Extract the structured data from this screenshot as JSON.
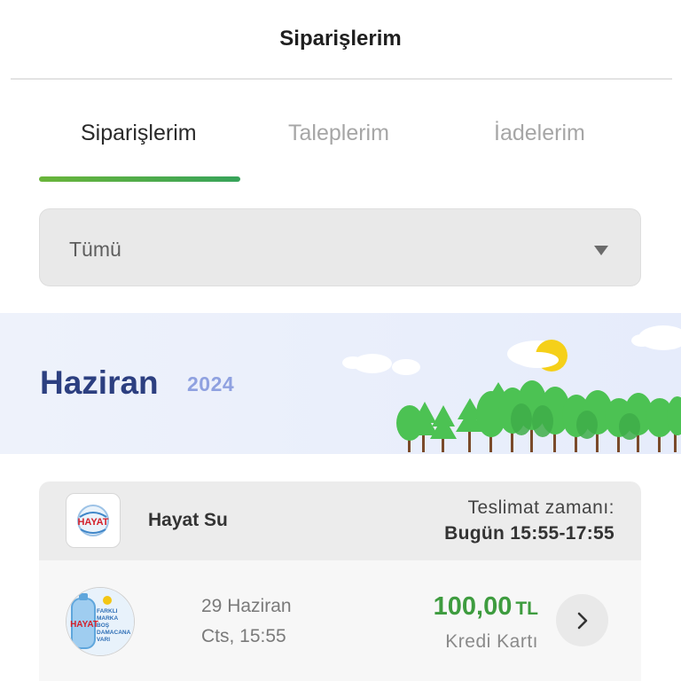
{
  "header": {
    "title": "Siparişlerim"
  },
  "tabs": [
    {
      "label": "Siparişlerim",
      "active": true
    },
    {
      "label": "Taleplerim",
      "active": false
    },
    {
      "label": "İadelerim",
      "active": false
    }
  ],
  "filter": {
    "selected": "Tümü"
  },
  "month_banner": {
    "month": "Haziran",
    "year": "2024"
  },
  "order": {
    "brand_name": "Hayat Su",
    "brand_logo_text": "HAYAT",
    "delivery_label": "Teslimat zamanı:",
    "delivery_time": "Bugün 15:55-17:55",
    "date": "29 Haziran",
    "time": "Cts, 15:55",
    "price": "100,00",
    "currency": "TL",
    "payment_method": "Kredi Kartı",
    "product_image_text": [
      "FARKLI",
      "MARKA",
      "BOŞ",
      "DAMACANA",
      "VARI"
    ]
  },
  "colors": {
    "accent_green": "#3e9c3f",
    "tab_underline": "#4fae45",
    "month_title": "#2c3f80",
    "year": "#8fa1e0"
  },
  "icons": {
    "filter_caret": "chevron-down-icon",
    "detail": "chevron-right-icon"
  }
}
